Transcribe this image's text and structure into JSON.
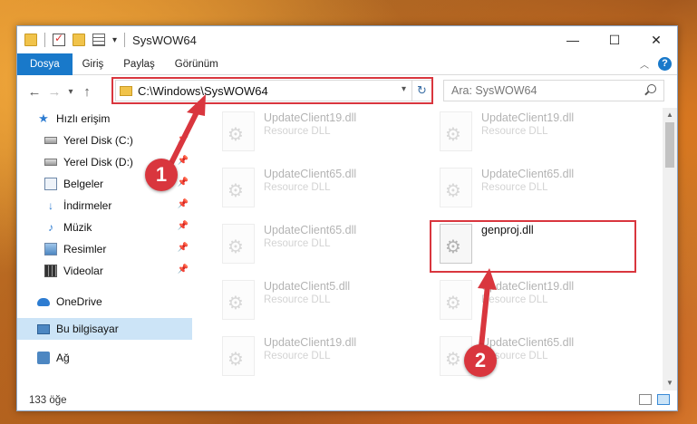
{
  "window": {
    "title": "SysWOW64",
    "controls": {
      "minimize": "—",
      "maximize": "☐",
      "close": "✕"
    }
  },
  "ribbon": {
    "tabs": [
      "Dosya",
      "Giriş",
      "Paylaş",
      "Görünüm"
    ],
    "help": "?"
  },
  "navigation": {
    "back": "←",
    "forward": "→",
    "recent": "▾",
    "up": "↑",
    "address": "C:\\Windows\\SysWOW64",
    "refresh": "↻",
    "search_placeholder": "Ara: SysWOW64"
  },
  "sidebar": {
    "items": [
      {
        "label": "Hızlı erişim",
        "icon": "star-icon"
      },
      {
        "label": "Yerel Disk (C:)",
        "icon": "drive-icon",
        "pinned": true
      },
      {
        "label": "Yerel Disk (D:)",
        "icon": "drive-icon",
        "pinned": true
      },
      {
        "label": "Belgeler",
        "icon": "documents-icon",
        "pinned": true
      },
      {
        "label": "İndirmeler",
        "icon": "download-icon",
        "pinned": true
      },
      {
        "label": "Müzik",
        "icon": "music-icon",
        "pinned": true
      },
      {
        "label": "Resimler",
        "icon": "pictures-icon",
        "pinned": true
      },
      {
        "label": "Videolar",
        "icon": "videos-icon",
        "pinned": true
      },
      {
        "label": "OneDrive",
        "icon": "onedrive-icon"
      },
      {
        "label": "Bu bilgisayar",
        "icon": "computer-icon",
        "selected": true
      },
      {
        "label": "Ağ",
        "icon": "network-icon"
      }
    ]
  },
  "files": [
    {
      "name": "UpdateClient19.dll",
      "type": "Resource DLL",
      "faded": true
    },
    {
      "name": "UpdateClient19.dll",
      "type": "Resource DLL",
      "faded": true
    },
    {
      "name": "UpdateClient65.dll",
      "type": "Resource DLL",
      "faded": true
    },
    {
      "name": "UpdateClient65.dll",
      "type": "Resource DLL",
      "faded": true
    },
    {
      "name": "UpdateClient65.dll",
      "type": "Resource DLL",
      "faded": true
    },
    {
      "name": "genproj.dll",
      "type": "",
      "faded": false
    },
    {
      "name": "UpdateClient5.dll",
      "type": "Resource DLL",
      "faded": true
    },
    {
      "name": "UpdateClient19.dll",
      "type": "Resource DLL",
      "faded": true
    },
    {
      "name": "UpdateClient19.dll",
      "type": "Resource DLL",
      "faded": true
    },
    {
      "name": "UpdateClient65.dll",
      "type": "Resource DLL",
      "faded": true
    }
  ],
  "status": {
    "item_count": "133 öğe"
  },
  "markers": {
    "one": "1",
    "two": "2"
  },
  "colors": {
    "accent": "#1979ca",
    "highlight": "#d9363e",
    "selection": "#cce4f7"
  }
}
